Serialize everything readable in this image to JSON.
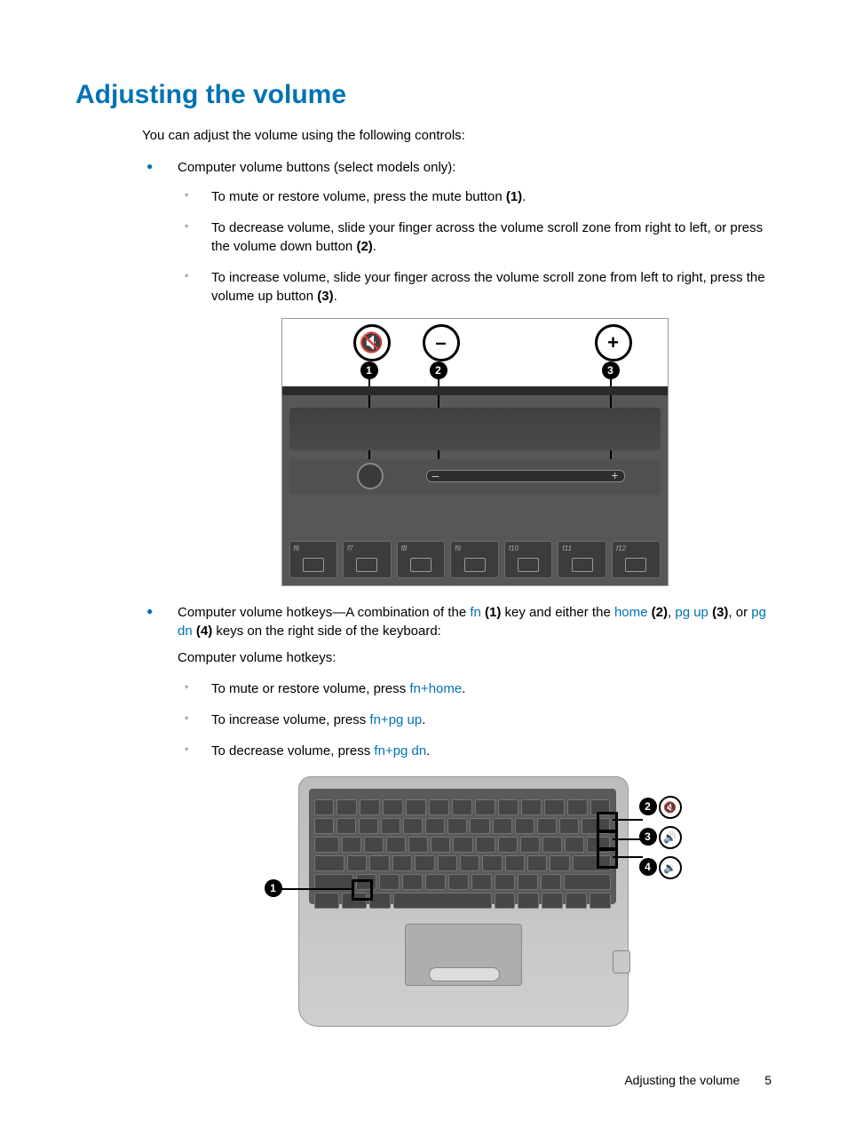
{
  "title": "Adjusting the volume",
  "intro": "You can adjust the volume using the following controls:",
  "bullet1_lead": "Computer volume buttons (select models only):",
  "b1_sub1_a": "To mute or restore volume, press the mute button ",
  "b1_sub1_b": "(1)",
  "b1_sub1_c": ".",
  "b1_sub2_a": "To decrease volume, slide your finger across the volume scroll zone from right to left, or press the volume down button ",
  "b1_sub2_b": "(2)",
  "b1_sub2_c": ".",
  "b1_sub3_a": "To increase volume, slide your finger across the volume scroll zone from left to right, press the volume up button ",
  "b1_sub3_b": "(3)",
  "b1_sub3_c": ".",
  "bullet2_a": "Computer volume hotkeys—A combination of the ",
  "bullet2_fn": "fn",
  "bullet2_b": " ",
  "bullet2_b1": "(1)",
  "bullet2_c": " key and either the ",
  "bullet2_home": "home",
  "bullet2_d": " ",
  "bullet2_d1": "(2)",
  "bullet2_e": ", ",
  "bullet2_pgup": "pg up",
  "bullet2_f": " ",
  "bullet2_f1": "(3)",
  "bullet2_g": ", or ",
  "bullet2_pgdn": "pg dn",
  "bullet2_h": " ",
  "bullet2_h1": "(4)",
  "bullet2_i": " keys on the right side of the keyboard:",
  "b2_para": "Computer volume hotkeys:",
  "b2_sub1_a": "To mute or restore volume, press ",
  "b2_sub1_k": "fn+home",
  "b2_sub1_c": ".",
  "b2_sub2_a": "To increase volume, press ",
  "b2_sub2_k": "fn+pg up",
  "b2_sub2_c": ".",
  "b2_sub3_a": "To decrease volume, press ",
  "b2_sub3_k": "fn+pg dn",
  "b2_sub3_c": ".",
  "fkeys": [
    "f6",
    "f7",
    "f8",
    "f9",
    "f10",
    "f11",
    "f12"
  ],
  "footer_title": "Adjusting the volume",
  "footer_page": "5",
  "callouts": {
    "n1": "1",
    "n2": "2",
    "n3": "3",
    "n4": "4"
  },
  "icons": {
    "mute": "🔇",
    "minus": "–",
    "plus": "+",
    "speaker": "🔊",
    "speaker_low": "🔉"
  }
}
